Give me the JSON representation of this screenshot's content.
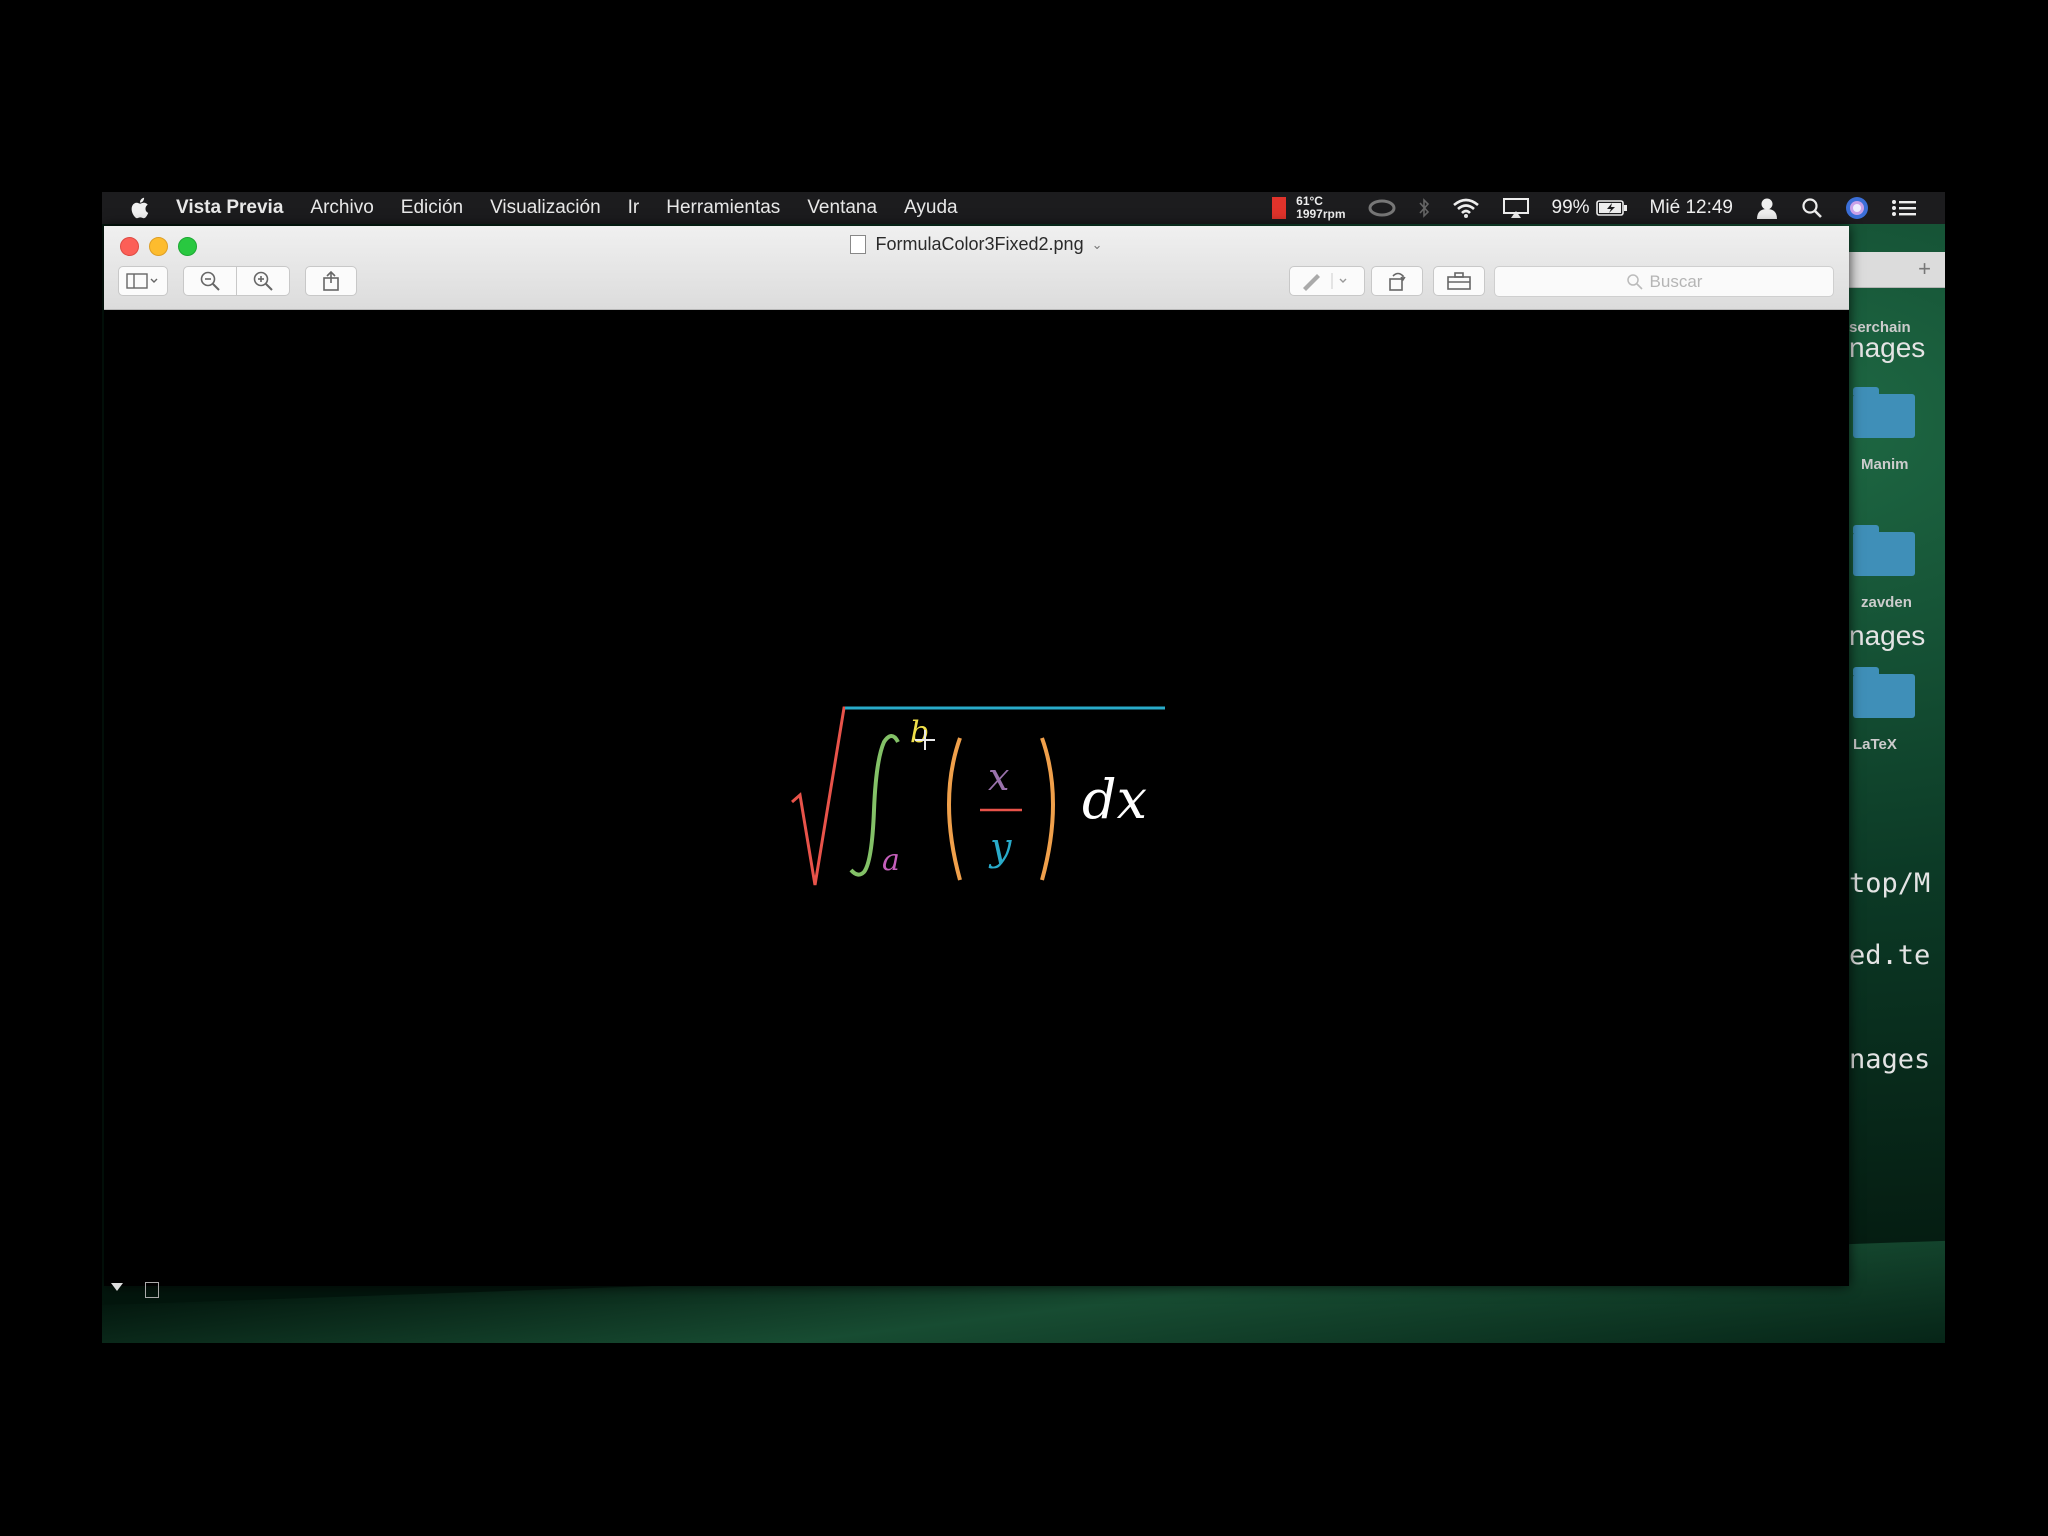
{
  "menubar": {
    "app_name": "Vista Previa",
    "menus": [
      "Archivo",
      "Edición",
      "Visualización",
      "Ir",
      "Herramientas",
      "Ventana",
      "Ayuda"
    ],
    "status": {
      "temperature": "61°C",
      "fan": "1997rpm",
      "battery": "99%",
      "clock": "Mié 12:49"
    },
    "colors": {
      "thermometer": "#e0332b"
    }
  },
  "window": {
    "title": "FormulaColor3Fixed2.png",
    "search_placeholder": "Buscar"
  },
  "side_panel": {
    "labels": [
      "serchain",
      "nages",
      "Manim",
      "zavden",
      "nages",
      "LaTeX",
      "top/M",
      "ed.te",
      "nages"
    ]
  },
  "formula": {
    "upper_limit": "b",
    "lower_limit": "a",
    "numerator": "x",
    "denominator": "y",
    "differential": "dx",
    "colors": {
      "radical": "#e8534a",
      "overline": "#29abca",
      "integral": "#83c167",
      "upper_limit": "#f0e04a",
      "lower_limit": "#c55fbb",
      "parentheses": "#f0a04b",
      "numerator": "#9a72ac",
      "denominator": "#29abca",
      "differential": "#ffffff"
    }
  }
}
